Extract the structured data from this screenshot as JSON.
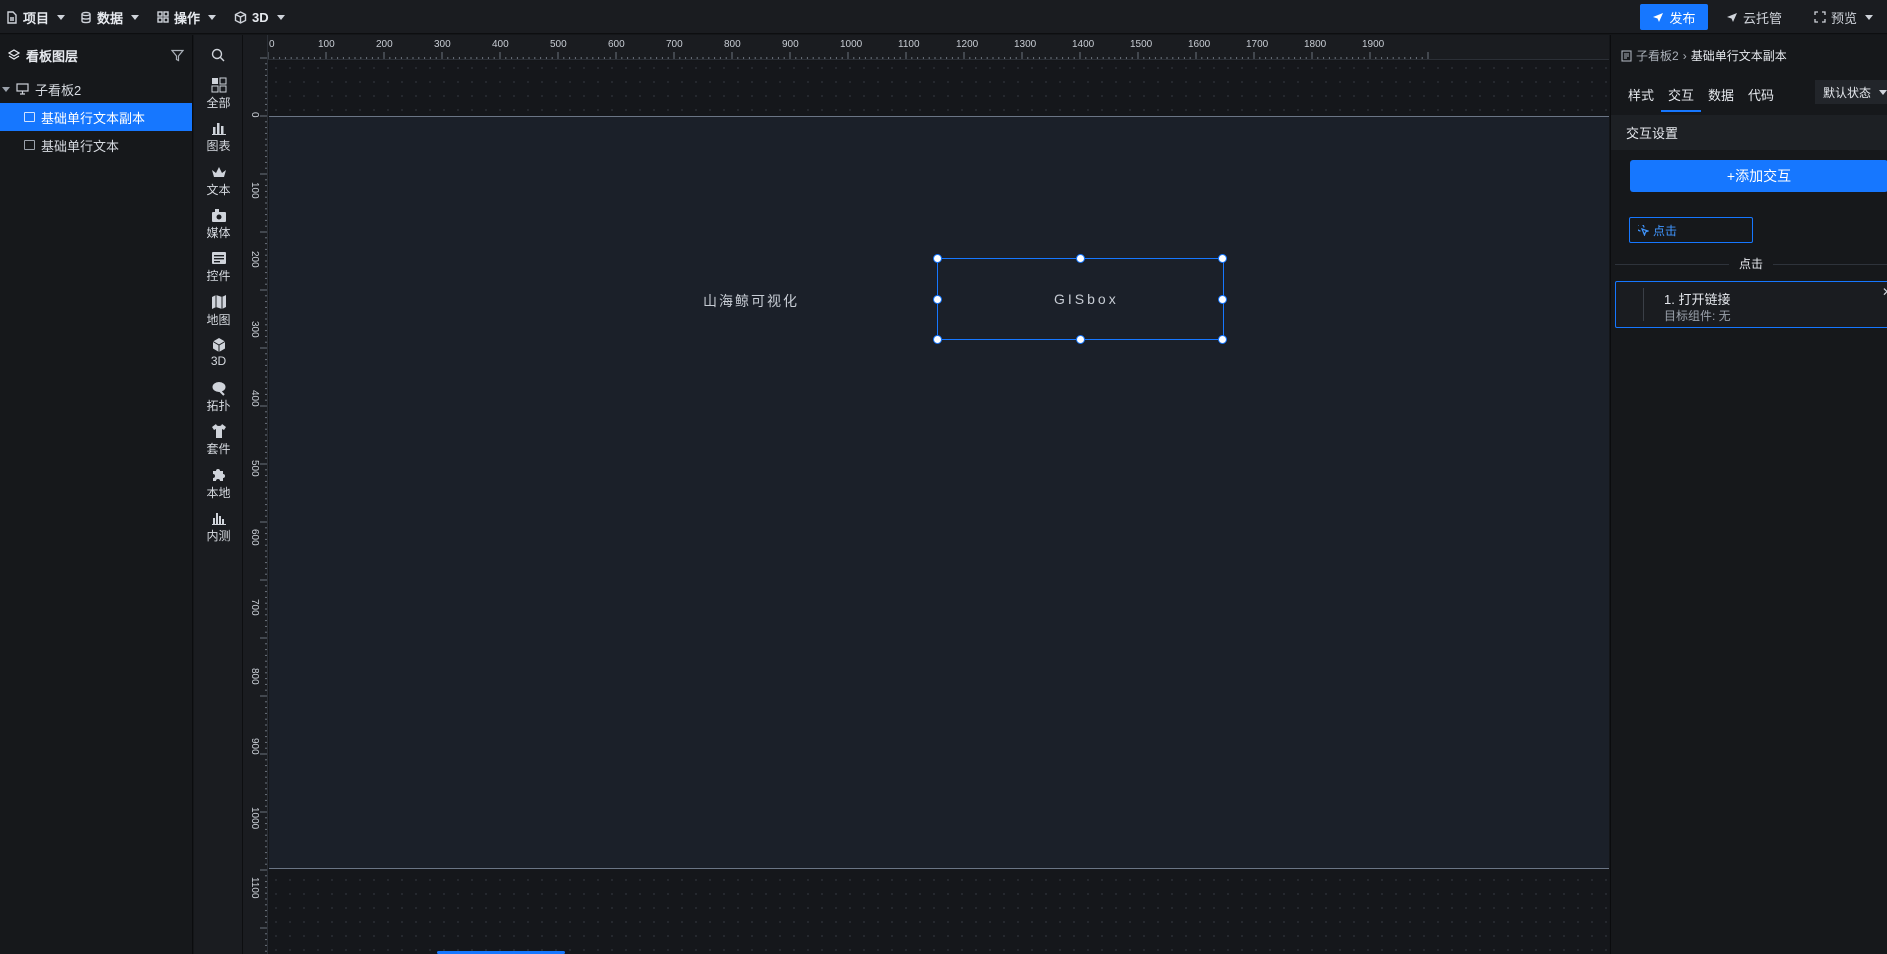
{
  "topbar": {
    "menus": [
      {
        "label": "项目",
        "icon": "file-icon"
      },
      {
        "label": "数据",
        "icon": "database-icon"
      },
      {
        "label": "操作",
        "icon": "grid-icon"
      },
      {
        "label": "3D",
        "icon": "cube-icon"
      }
    ],
    "publish": "发布",
    "cloud": "云托管",
    "preview": "预览"
  },
  "layers": {
    "title": "看板图层",
    "items": [
      {
        "label": "子看板2",
        "level": 0,
        "selected": false
      },
      {
        "label": "基础单行文本副本",
        "level": 1,
        "selected": true
      },
      {
        "label": "基础单行文本",
        "level": 1,
        "selected": false
      }
    ]
  },
  "rail": {
    "items": [
      {
        "label": "全部",
        "icon": "grid-icon"
      },
      {
        "label": "图表",
        "icon": "bar-chart-icon"
      },
      {
        "label": "文本",
        "icon": "crown-text-icon"
      },
      {
        "label": "媒体",
        "icon": "media-icon"
      },
      {
        "label": "控件",
        "icon": "controls-icon"
      },
      {
        "label": "地图",
        "icon": "map-icon"
      },
      {
        "label": "3D",
        "icon": "cube-icon"
      },
      {
        "label": "拓扑",
        "icon": "topology-icon"
      },
      {
        "label": "套件",
        "icon": "shirt-icon"
      },
      {
        "label": "本地",
        "icon": "puzzle-icon"
      },
      {
        "label": "内测",
        "icon": "beta-chart-icon"
      }
    ]
  },
  "ruler": {
    "h_labels": [
      "0",
      "100",
      "200",
      "300",
      "400",
      "500",
      "600",
      "700",
      "800",
      "900",
      "1000",
      "1100",
      "1200",
      "1300",
      "1400",
      "1500",
      "1600",
      "1700",
      "1800",
      "1900"
    ],
    "v_labels": [
      "0",
      "100",
      "200",
      "300",
      "400",
      "500",
      "600",
      "700",
      "800",
      "900",
      "1000",
      "1100"
    ]
  },
  "canvas": {
    "text1": "山海鲸可视化",
    "text2": "GISbox"
  },
  "rpanel": {
    "crumb_parent": "子看板2",
    "crumb_current": "基础单行文本副本",
    "tabs": [
      "样式",
      "交互",
      "数据",
      "代码"
    ],
    "active_tab": "交互",
    "state": "默认状态",
    "section": "交互设置",
    "add_button": "+添加交互",
    "trigger": "点击",
    "divider": "点击",
    "action_title": "1. 打开链接",
    "action_sub": "目标组件: 无"
  },
  "colors": {
    "accent": "#1677ff",
    "board": "#1b2029",
    "panel": "#16181b"
  }
}
